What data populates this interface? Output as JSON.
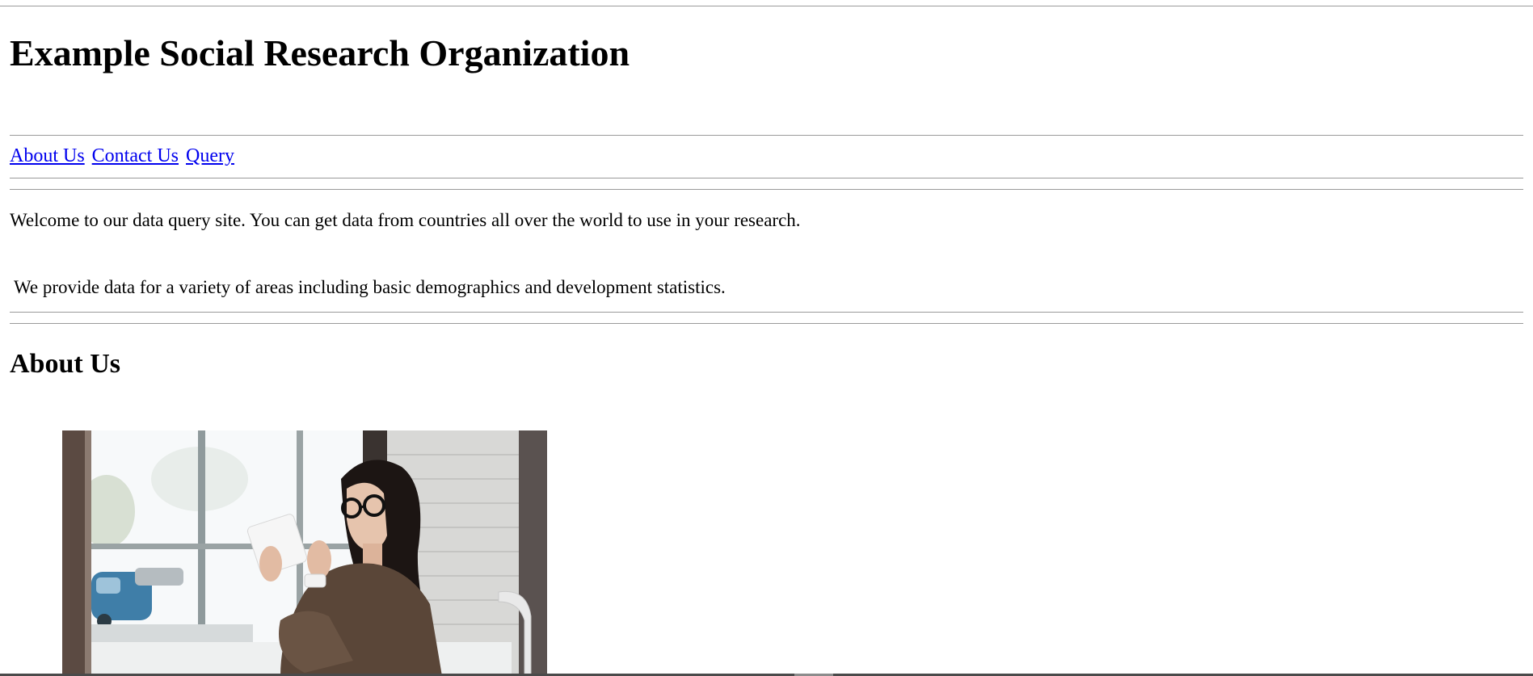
{
  "header": {
    "title": "Example Social Research Organization"
  },
  "nav": {
    "items": [
      {
        "label": "About Us"
      },
      {
        "label": "Contact Us"
      },
      {
        "label": "Query"
      }
    ]
  },
  "intro": {
    "line1": "Welcome to our data query site. You can get data from countries all over the world to use in your research.",
    "line2": "We provide data for a variety of areas including basic demographics and development statistics."
  },
  "about": {
    "heading": "About Us",
    "image_icon": "photo-woman-with-tablet"
  },
  "colors": {
    "link": "#0000ee",
    "rule": "#9a9a9a",
    "text": "#000000"
  }
}
